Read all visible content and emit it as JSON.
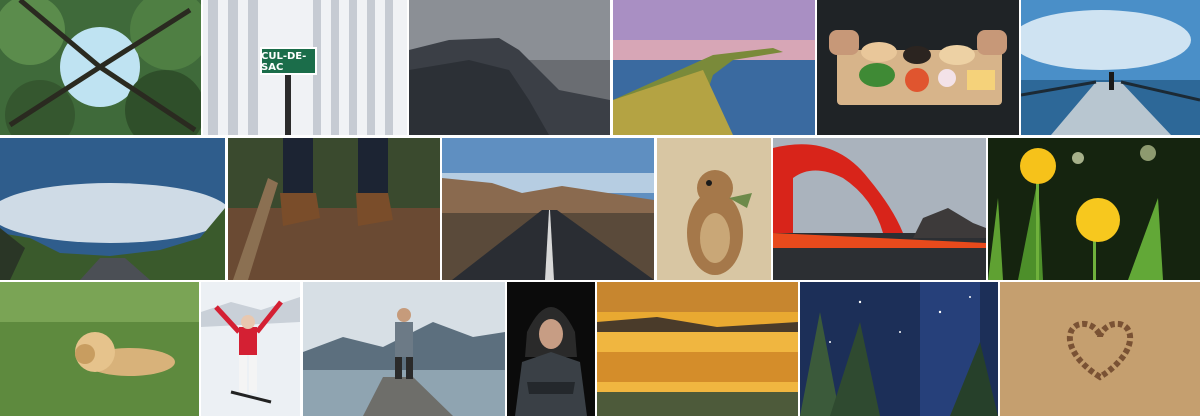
{
  "gallery": {
    "rows": [
      {
        "tiles": [
          {
            "name": "tree-canopy-photo"
          },
          {
            "name": "cul-de-sac-sign-photo",
            "sign_text": "CUL-DE-SAC"
          },
          {
            "name": "stormy-cliff-photo"
          },
          {
            "name": "coastal-peninsula-photo"
          },
          {
            "name": "burger-prep-photo"
          },
          {
            "name": "pier-sky-photo"
          }
        ]
      },
      {
        "tiles": [
          {
            "name": "open-road-sky-photo"
          },
          {
            "name": "hiking-boots-photo"
          },
          {
            "name": "desert-highway-photo"
          },
          {
            "name": "prairie-dog-photo"
          },
          {
            "name": "lava-fountain-photo"
          },
          {
            "name": "dandelions-photo"
          }
        ]
      },
      {
        "tiles": [
          {
            "name": "resting-lion-photo"
          },
          {
            "name": "skier-photo"
          },
          {
            "name": "lake-dock-man-photo"
          },
          {
            "name": "hooded-man-photo"
          },
          {
            "name": "sunset-lake-photo"
          },
          {
            "name": "night-sky-trees-photo"
          },
          {
            "name": "pebble-heart-photo"
          }
        ]
      }
    ]
  }
}
